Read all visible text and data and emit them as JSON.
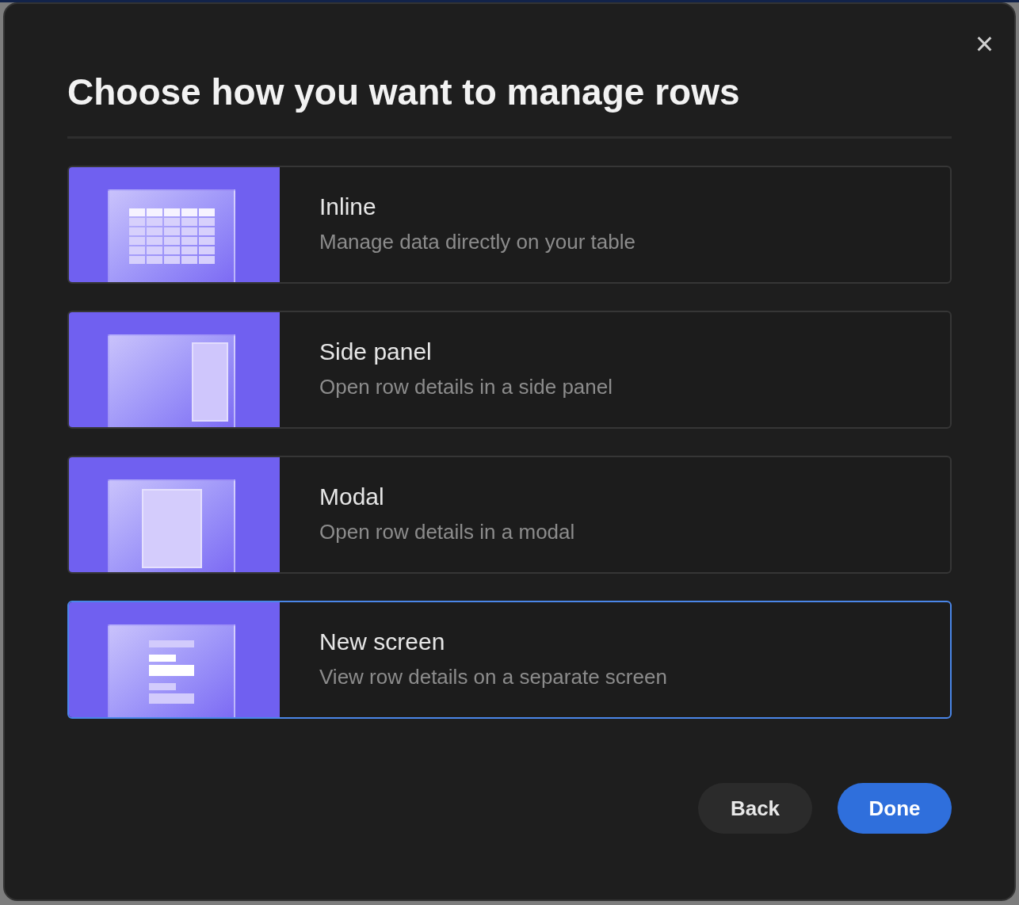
{
  "dialog": {
    "title": "Choose how you want to manage rows",
    "close": "×"
  },
  "options": [
    {
      "kind": "inline",
      "title": "Inline",
      "description": "Manage data directly on your table",
      "selected": false
    },
    {
      "kind": "side_panel",
      "title": "Side panel",
      "description": "Open row details in a side panel",
      "selected": false
    },
    {
      "kind": "modal",
      "title": "Modal",
      "description": "Open row details in a modal",
      "selected": false
    },
    {
      "kind": "new_screen",
      "title": "New screen",
      "description": "View row details on a separate screen",
      "selected": true
    }
  ],
  "buttons": [
    {
      "kind": "secondary",
      "label": "Back"
    },
    {
      "kind": "primary",
      "label": "Done"
    }
  ]
}
